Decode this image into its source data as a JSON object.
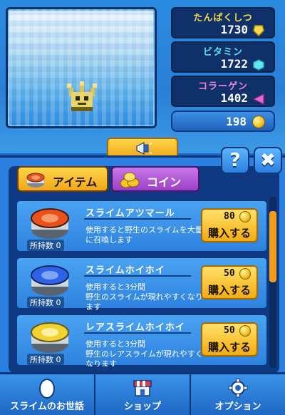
{
  "stats": {
    "protein": {
      "label": "たんぱくしつ",
      "value": "1730",
      "color": "#f6d84b"
    },
    "vitamin": {
      "label": "ビタミン",
      "value": "1722",
      "color": "#5fe6ef"
    },
    "collagen": {
      "label": "コラーゲン",
      "value": "1402",
      "color": "#f287d8"
    }
  },
  "coins": {
    "value": "198"
  },
  "tabs": {
    "items": {
      "label": "アイテム"
    },
    "coins": {
      "label": "コイン"
    }
  },
  "buttons": {
    "help": "?",
    "close": "✖"
  },
  "items": [
    {
      "name": "スライムアツマール",
      "desc": "使用すると野生のスライムを大量に召喚します",
      "owned": "所持数 0",
      "price": "80",
      "buy_label": "購入する",
      "can_color": "#e8501c"
    },
    {
      "name": "スライムホイホイ",
      "desc": "使用すると3分間\n野生のスライムが現れやすくなります",
      "owned": "所持数 0",
      "price": "50",
      "buy_label": "購入する",
      "can_color": "#2f63e6"
    },
    {
      "name": "レアスライムホイホイ",
      "desc": "使用すると3分間\n野生のレアスライムが現れやすくなります",
      "owned": "所持数 0",
      "price": "50",
      "buy_label": "購入する",
      "can_color": "#f0d233"
    }
  ],
  "nav": {
    "care": "スライムのお世話",
    "shop": "ショップ",
    "options": "オプション"
  }
}
